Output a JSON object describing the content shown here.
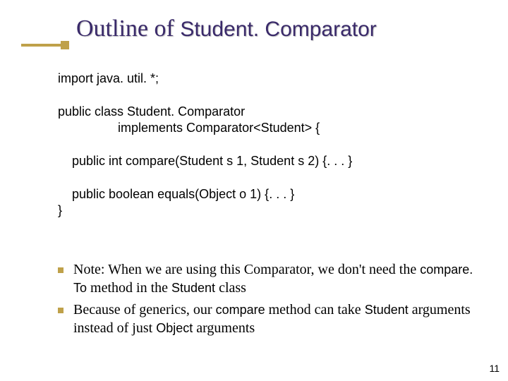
{
  "title": {
    "prefix": "Outline of ",
    "mono": "Student. Comparator"
  },
  "code": {
    "l1": "import java. util. *;",
    "l2": "public class Student. Comparator",
    "l3": "                 implements Comparator<Student> {",
    "l4": "    public int compare(Student s 1, Student s 2) {. . . }",
    "l5": "    public boolean equals(Object o 1) {. . . }",
    "l6": "}"
  },
  "notes": {
    "n1": {
      "a": "Note: When we are using this Comparator, we don't need the ",
      "b": "compare. To",
      "c": " method in the ",
      "d": "Student",
      "e": " class"
    },
    "n2": {
      "a": "Because of generics, our ",
      "b": "compare",
      "c": " method can take ",
      "d": "Student",
      "e": " arguments instead of just ",
      "f": "Object",
      "g": " arguments"
    }
  },
  "page": "11"
}
